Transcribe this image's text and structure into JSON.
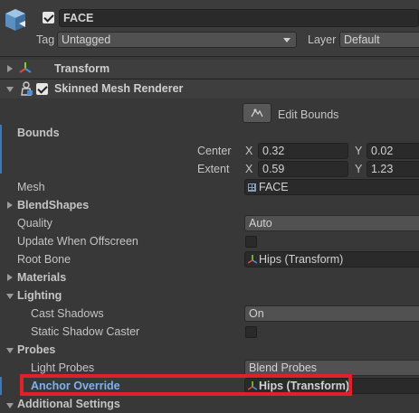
{
  "header": {
    "object_name": "FACE",
    "tag_label": "Tag",
    "tag_value": "Untagged",
    "layer_label": "Layer",
    "layer_value": "Default"
  },
  "components": {
    "transform": "Transform",
    "smr": "Skinned Mesh Renderer"
  },
  "edit_bounds": "Edit Bounds",
  "bounds": {
    "label": "Bounds",
    "center_label": "Center",
    "extent_label": "Extent",
    "x_label": "X",
    "y_label": "Y",
    "center_x": "0.32",
    "center_y": "0.02",
    "extent_x": "0.59",
    "extent_y": "1.23"
  },
  "props": {
    "mesh_label": "Mesh",
    "mesh_value": "FACE",
    "blendshapes": "BlendShapes",
    "quality_label": "Quality",
    "quality_value": "Auto",
    "update_label": "Update When Offscreen",
    "root_bone_label": "Root Bone",
    "root_bone_value": "Hips (Transform)",
    "materials": "Materials",
    "lighting": "Lighting",
    "cast_shadows_label": "Cast Shadows",
    "cast_shadows_value": "On",
    "static_shadow_label": "Static Shadow Caster",
    "probes": "Probes",
    "light_probes_label": "Light Probes",
    "light_probes_value": "Blend Probes",
    "anchor_label": "Anchor Override",
    "anchor_value": "Hips (Transform)",
    "additional": "Additional Settings"
  },
  "colors": {
    "background": "#383838",
    "highlight_red": "#e0202a",
    "anchor_blue": "#7fb2f0",
    "selection_bar": "#3a79bb"
  },
  "icons": [
    "gameobject-cube-icon",
    "transform-axes-icon",
    "skinned-mesh-icon",
    "edit-bounds-icon",
    "mesh-grid-icon",
    "bone-icon"
  ]
}
